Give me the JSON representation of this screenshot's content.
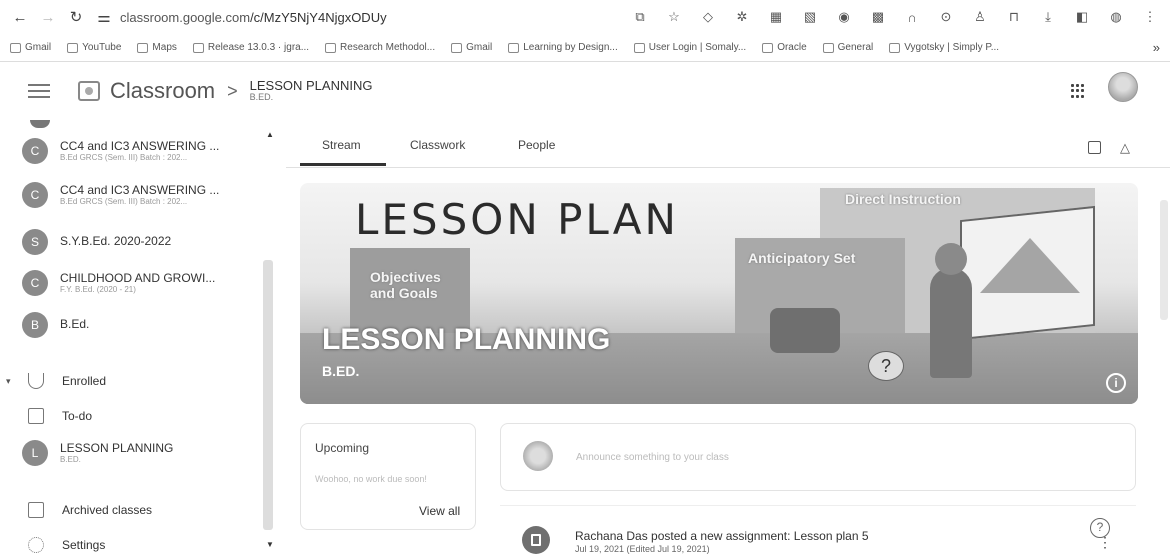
{
  "browser": {
    "url_host": "classroom.google.com",
    "url_path": "/c/MzY5NjY4NjgxODUy",
    "bookmarks": [
      "Gmail",
      "YouTube",
      "Maps",
      "Release 13.0.3 · jgra...",
      "Research Methodol...",
      "Gmail",
      "Learning by Design...",
      "User Login | Somaly...",
      "Oracle",
      "General",
      "Vygotsky | Simply P..."
    ],
    "more": "»"
  },
  "header": {
    "brand": "Classroom",
    "separator": ">",
    "class_title": "LESSON PLANNING",
    "class_subtitle": "B.ED."
  },
  "sidebar": {
    "classes": [
      {
        "initial": "C",
        "name": "CC4 and IC3 ANSWERING ...",
        "sub": "B.Ed GRCS (Sem. III) Batch : 202..."
      },
      {
        "initial": "C",
        "name": "CC4 and IC3 ANSWERING ...",
        "sub": "B.Ed GRCS (Sem. III) Batch : 202..."
      },
      {
        "initial": "S",
        "name": "S.Y.B.Ed. 2020-2022",
        "sub": ""
      },
      {
        "initial": "C",
        "name": "CHILDHOOD AND GROWI...",
        "sub": "F.Y. B.Ed. (2020 - 21)"
      },
      {
        "initial": "B",
        "name": "B.Ed.",
        "sub": ""
      }
    ],
    "enrolled_label": "Enrolled",
    "todo_label": "To-do",
    "enrolled_class": {
      "initial": "L",
      "name": "LESSON PLANNING",
      "sub": "B.ED."
    },
    "archived_label": "Archived classes",
    "settings_label": "Settings"
  },
  "tabs": {
    "stream": "Stream",
    "classwork": "Classwork",
    "people": "People"
  },
  "banner": {
    "big_title": "LESSON PLAN",
    "label_direct": "Direct Instruction",
    "label_anticipatory": "Anticipatory Set",
    "label_objectives": "Objectives\nand Goals",
    "class_name": "LESSON PLANNING",
    "class_sub": "B.ED.",
    "info": "i"
  },
  "upcoming": {
    "title": "Upcoming",
    "sub": "Woohoo, no work due soon!",
    "view_all": "View all"
  },
  "stream": {
    "announce_placeholder": "Announce something to your class",
    "post_title": "Rachana Das posted a new assignment: Lesson plan 5",
    "post_date": "Jul 19, 2021 (Edited Jul 19, 2021)"
  },
  "icons": {
    "back": "back-icon",
    "forward": "forward-icon",
    "reload": "reload-icon",
    "apps": "apps-grid-icon",
    "help": "help-icon"
  }
}
